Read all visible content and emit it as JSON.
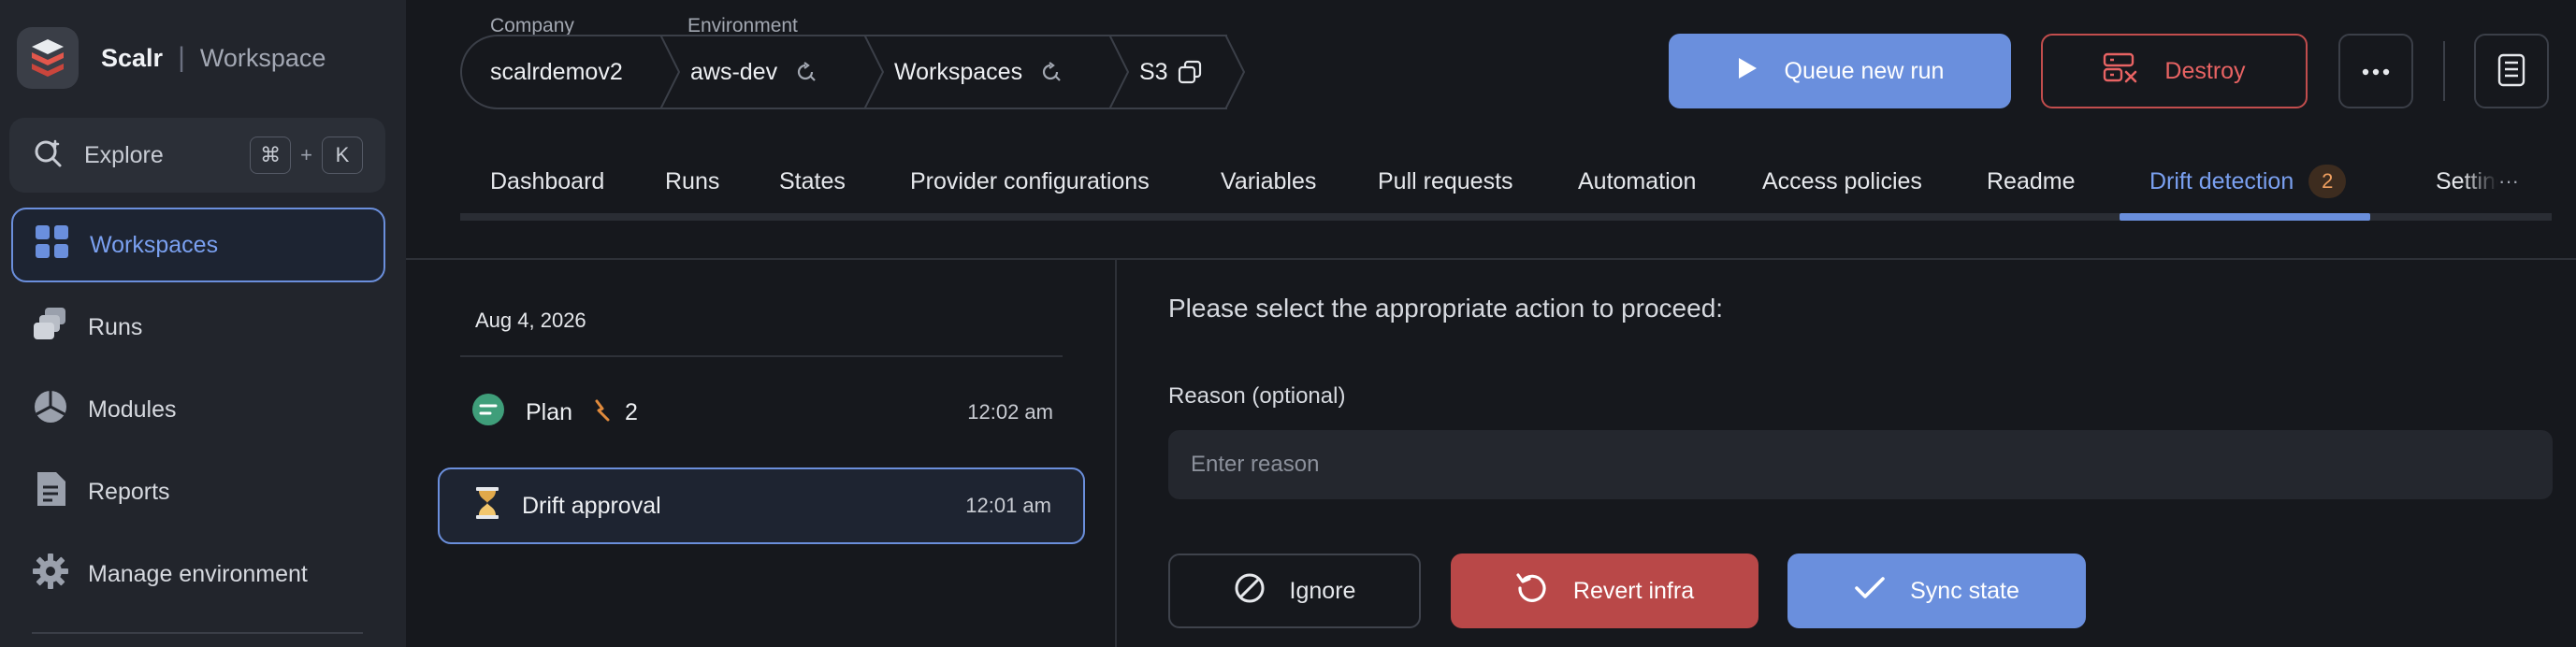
{
  "sidebar": {
    "brand": {
      "name": "Scalr",
      "separator": "|",
      "workspace": "Workspace"
    },
    "explore": {
      "label": "Explore",
      "shortcut_mod": "⌘",
      "shortcut_plus": "+",
      "shortcut_key": "K"
    },
    "items": [
      {
        "label": "Workspaces",
        "icon": "grid-icon",
        "active": true
      },
      {
        "label": "Runs",
        "icon": "runs-icon",
        "active": false
      },
      {
        "label": "Modules",
        "icon": "modules-icon",
        "active": false
      },
      {
        "label": "Reports",
        "icon": "reports-icon",
        "active": false
      },
      {
        "label": "Manage environment",
        "icon": "gear-icon",
        "active": false
      }
    ]
  },
  "breadcrumb": {
    "company_label": "Company",
    "environment_label": "Environment",
    "items": [
      {
        "label": "scalrdemov2"
      },
      {
        "label": "aws-dev",
        "action_icon": "switch-icon"
      },
      {
        "label": "Workspaces",
        "action_icon": "switch-icon"
      },
      {
        "label": "S3",
        "action_icon": "copy-icon"
      }
    ]
  },
  "toolbar": {
    "queue_label": "Queue new run",
    "destroy_label": "Destroy"
  },
  "tabs": {
    "items": [
      {
        "label": "Dashboard"
      },
      {
        "label": "Runs"
      },
      {
        "label": "States"
      },
      {
        "label": "Provider configurations"
      },
      {
        "label": "Variables"
      },
      {
        "label": "Pull requests"
      },
      {
        "label": "Automation"
      },
      {
        "label": "Access policies"
      },
      {
        "label": "Readme"
      },
      {
        "label": "Drift detection",
        "badge": "2",
        "active": true
      },
      {
        "label": "Settings"
      }
    ],
    "overflow": "···"
  },
  "runs": {
    "date": "Aug 4, 2026",
    "items": [
      {
        "label": "Plan",
        "count": "2",
        "time": "12:02 am",
        "status": "plan-icon"
      },
      {
        "label": "Drift approval",
        "time": "12:01 am",
        "status": "hourglass-icon",
        "selected": true
      }
    ]
  },
  "action": {
    "prompt": "Please select the appropriate action to proceed:",
    "reason_label": "Reason (optional)",
    "reason_placeholder": "Enter reason",
    "reason_value": "",
    "ignore_label": "Ignore",
    "revert_label": "Revert infra",
    "sync_label": "Sync state"
  },
  "colors": {
    "accent": "#6a8fdd",
    "danger": "#c24d4d",
    "badge": "#f0a060",
    "background": "#16181d",
    "sidebar": "#22252c"
  }
}
